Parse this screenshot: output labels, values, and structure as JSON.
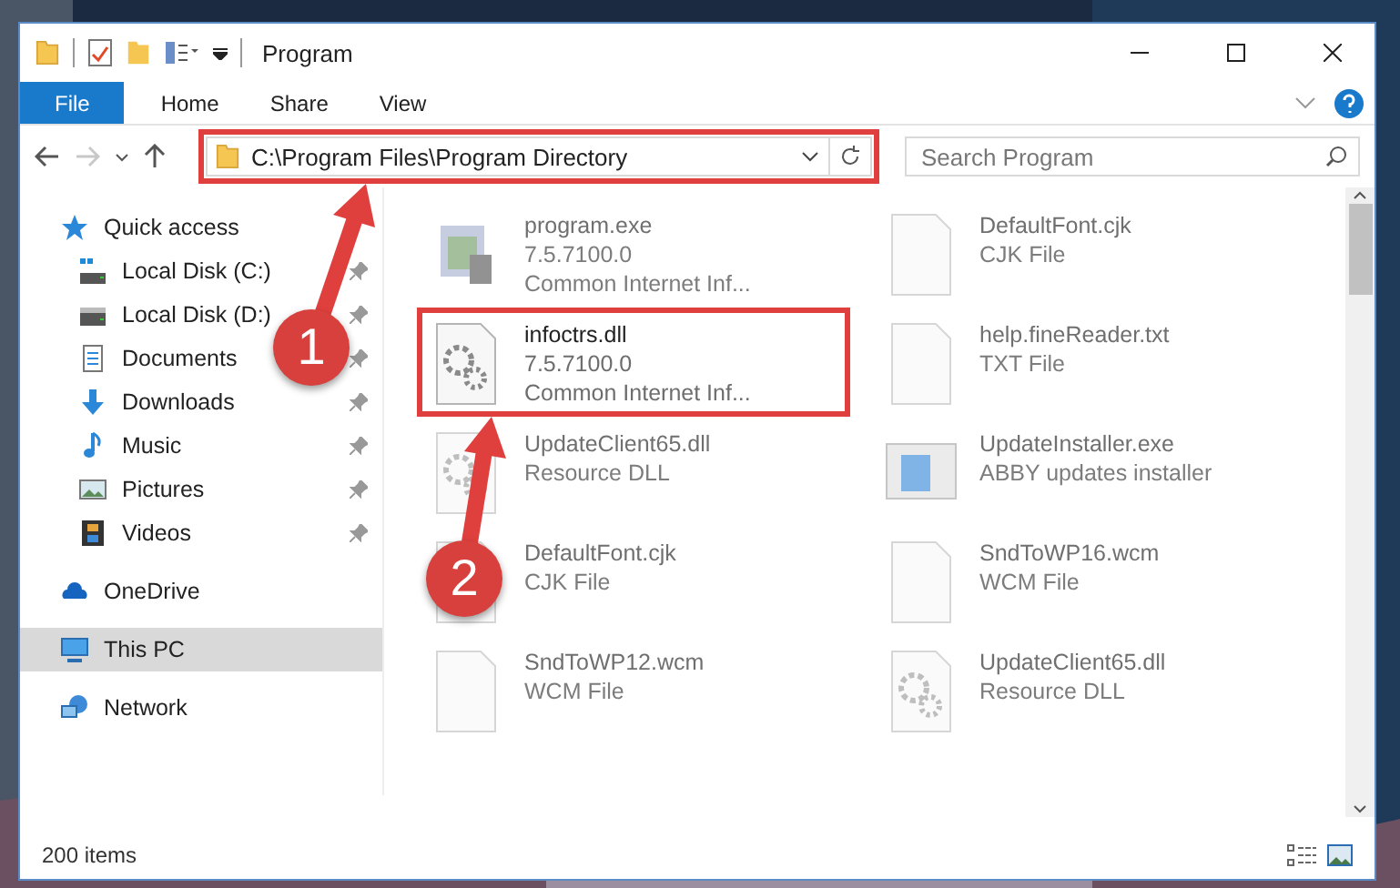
{
  "window": {
    "title": "Program"
  },
  "ribbon_tabs": [
    {
      "label": "File",
      "kind": "file"
    },
    {
      "label": "Home",
      "kind": "tab"
    },
    {
      "label": "Share",
      "kind": "tab"
    },
    {
      "label": "View",
      "kind": "tab"
    }
  ],
  "address_bar": {
    "path": "C:\\Program Files\\Program Directory",
    "highlighted": true
  },
  "forward_button": {
    "disabled": true
  },
  "search": {
    "placeholder": "Search Program"
  },
  "nav_pane": [
    {
      "label": "Quick access",
      "kind": "star",
      "selected": false,
      "children": [
        {
          "label": "Local Disk (C:)",
          "kind": "systemdrive",
          "pinned": true,
          "selected": false
        },
        {
          "label": "Local Disk (D:)",
          "kind": "drive",
          "pinned": true,
          "selected": false
        },
        {
          "label": "Documents",
          "kind": "documents",
          "pinned": true,
          "selected": false
        },
        {
          "label": "Downloads",
          "kind": "downloads",
          "pinned": true,
          "selected": false
        },
        {
          "label": "Music",
          "kind": "music",
          "pinned": true,
          "selected": false
        },
        {
          "label": "Pictures",
          "kind": "pictures",
          "pinned": true,
          "selected": false
        },
        {
          "label": "Videos",
          "kind": "videos",
          "pinned": true,
          "selected": false
        }
      ]
    },
    {
      "label": "OneDrive",
      "kind": "cloud",
      "selected": false
    },
    {
      "label": "This PC",
      "kind": "computer",
      "selected": true
    },
    {
      "label": "Network",
      "kind": "network",
      "selected": false
    }
  ],
  "files": [
    {
      "name": "program.exe",
      "details": [
        "7.5.7100.0",
        "Common Internet Inf..."
      ],
      "kind": "installer",
      "dimmed": true,
      "highlighted": false
    },
    {
      "name": "DefaultFont.cjk",
      "details": [
        "CJK File"
      ],
      "kind": "document",
      "dimmed": true,
      "highlighted": false
    },
    {
      "name": "infoctrs.dll",
      "details": [
        "7.5.7100.0",
        "Common Internet Inf..."
      ],
      "kind": "library",
      "dimmed": false,
      "highlighted": true
    },
    {
      "name": "help.fineReader.txt",
      "details": [
        "TXT File"
      ],
      "kind": "document",
      "dimmed": true,
      "highlighted": false
    },
    {
      "name": "UpdateClient65.dll",
      "details": [
        "Resource DLL"
      ],
      "kind": "library",
      "dimmed": true,
      "highlighted": false
    },
    {
      "name": "UpdateInstaller.exe",
      "details": [
        "ABBY updates installer"
      ],
      "kind": "application",
      "dimmed": true,
      "highlighted": false
    },
    {
      "name": "DefaultFont.cjk",
      "details": [
        "CJK File"
      ],
      "kind": "document",
      "dimmed": true,
      "highlighted": false
    },
    {
      "name": "SndToWP16.wcm",
      "details": [
        "WCM File"
      ],
      "kind": "document",
      "dimmed": true,
      "highlighted": false
    },
    {
      "name": "SndToWP12.wcm",
      "details": [
        "WCM File"
      ],
      "kind": "document",
      "dimmed": true,
      "highlighted": false
    },
    {
      "name": "UpdateClient65.dll",
      "details": [
        "Resource DLL"
      ],
      "kind": "library",
      "dimmed": true,
      "highlighted": false
    }
  ],
  "status_bar": {
    "item_count": "200 items"
  },
  "annotations": [
    {
      "label": "1"
    },
    {
      "label": "2"
    }
  ]
}
